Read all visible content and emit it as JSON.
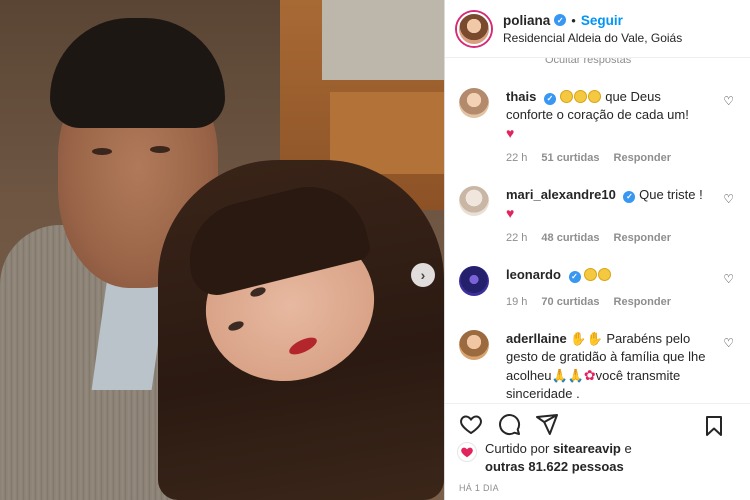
{
  "post": {
    "username": "poliana",
    "follow_label": "Seguir",
    "location": "Residencial Aldeia do Vale, Goiás",
    "dot": "•",
    "hide_replies": "Ocultar respostas"
  },
  "comments": [
    {
      "user": "thais",
      "text": "que Deus conforte o coração de cada um!",
      "time": "22 h",
      "likes": "51 curtidas",
      "reply": "Responder"
    },
    {
      "user": "mari_alexandre10",
      "text": "Que triste !",
      "time": "22 h",
      "likes": "48 curtidas",
      "reply": "Responder"
    },
    {
      "user": "leonardo",
      "text": "",
      "time": "19 h",
      "likes": "70 curtidas",
      "reply": "Responder"
    },
    {
      "user": "aderllaine",
      "text_a": "Parabéns pelo gesto de gratidão à família que lhe acolheu",
      "text_b": "você transmite sinceridade ."
    }
  ],
  "likes": {
    "prefix": "Curtido por",
    "user": "siteareavip",
    "conj": "e",
    "others": "outras 81.622 pessoas"
  },
  "time_ago": "HÁ 1 DIA",
  "colors": {
    "accent": "#0095f6",
    "verified": "#3897f0",
    "heart": "#e0245e"
  },
  "icons": [
    "verified-icon",
    "heart-icon",
    "comment-icon",
    "share-icon",
    "bookmark-icon",
    "chevron-right-icon"
  ]
}
